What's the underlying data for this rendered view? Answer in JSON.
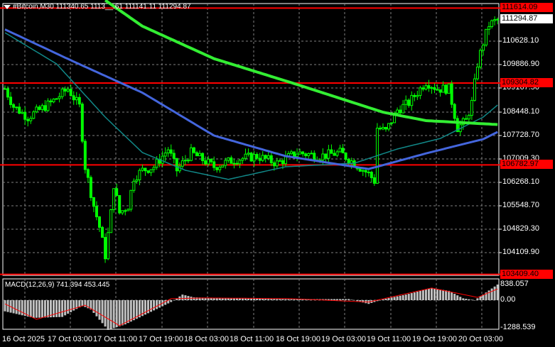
{
  "header": {
    "title": "#Bitcoin,M30  111340.65 1113__.61 111141.11 111294.87",
    "menu_icon": "triangle-down-icon"
  },
  "price_axis": {
    "ticks": [
      "110628.10",
      "109886.90",
      "109167.50",
      "108448.10",
      "107728.70",
      "107009.30",
      "106268.10",
      "105548.70",
      "104829.30",
      "104109.90"
    ],
    "current_price": "111294.87",
    "levels": [
      "111614.09",
      "109304.82",
      "106782.97",
      "103409.40"
    ]
  },
  "macd": {
    "title": "MACD(12,26,9) 741.394 453.445",
    "axis": [
      "838.057",
      "0.00",
      "-1288.539"
    ]
  },
  "time_axis": [
    "16 Oct 2025",
    "17 Oct 03:00",
    "17 Oct 11:00",
    "17 Oct 19:00",
    "18 Oct 03:00",
    "18 Oct 11:00",
    "18 Oct 19:00",
    "19 Oct 03:00",
    "19 Oct 11:00",
    "19 Oct 19:00",
    "20 Oct 03:00"
  ],
  "colors": {
    "candle": "#00ff00",
    "ma_slow": "#33ee33",
    "ma_mid": "#4466dd",
    "ma_fast": "#118888",
    "level": "#ff0000",
    "grid": "#808080",
    "signal": "#ff0000",
    "hist": "#c0c0c0"
  },
  "chart_data": {
    "type": "candlestick",
    "symbol": "#Bitcoin",
    "timeframe": "M30",
    "bars": 173,
    "price_range": [
      103409.4,
      111614.09
    ],
    "close_keypoints": [
      [
        0,
        109174
      ],
      [
        3,
        108627
      ],
      [
        8,
        108299
      ],
      [
        16,
        108737
      ],
      [
        22,
        109174
      ],
      [
        26,
        108627
      ],
      [
        28,
        106769
      ],
      [
        31,
        105567
      ],
      [
        33,
        104911
      ],
      [
        35,
        104036
      ],
      [
        37,
        105348
      ],
      [
        38,
        106222
      ],
      [
        40,
        105348
      ],
      [
        43,
        105567
      ],
      [
        45,
        106441
      ],
      [
        48,
        106660
      ],
      [
        52,
        106769
      ],
      [
        57,
        107316
      ],
      [
        60,
        106660
      ],
      [
        65,
        107206
      ],
      [
        73,
        106769
      ],
      [
        80,
        106987
      ],
      [
        88,
        107097
      ],
      [
        95,
        106878
      ],
      [
        102,
        107206
      ],
      [
        110,
        107097
      ],
      [
        117,
        107206
      ],
      [
        122,
        106878
      ],
      [
        127,
        106550
      ],
      [
        129,
        106331
      ],
      [
        130,
        107971
      ],
      [
        133,
        107862
      ],
      [
        137,
        108518
      ],
      [
        141,
        108737
      ],
      [
        145,
        109174
      ],
      [
        147,
        109393
      ],
      [
        151,
        109174
      ],
      [
        155,
        109174
      ],
      [
        158,
        107971
      ],
      [
        161,
        108190
      ],
      [
        163,
        108737
      ],
      [
        165,
        109940
      ],
      [
        167,
        110595
      ],
      [
        169,
        111142
      ],
      [
        172,
        111295
      ]
    ],
    "ma_slow": [
      [
        35,
        111900
      ],
      [
        48,
        111100
      ],
      [
        73,
        110100
      ],
      [
        102,
        109304
      ],
      [
        132,
        108450
      ],
      [
        147,
        108190
      ],
      [
        172,
        108070
      ]
    ],
    "ma_mid": [
      [
        0,
        111000
      ],
      [
        23,
        110050
      ],
      [
        48,
        109050
      ],
      [
        73,
        107730
      ],
      [
        98,
        107097
      ],
      [
        127,
        106700
      ],
      [
        147,
        107180
      ],
      [
        167,
        107620
      ],
      [
        172,
        107840
      ]
    ],
    "ma_fast": [
      [
        0,
        110900
      ],
      [
        18,
        109940
      ],
      [
        35,
        108299
      ],
      [
        48,
        107206
      ],
      [
        63,
        106660
      ],
      [
        78,
        106380
      ],
      [
        98,
        106769
      ],
      [
        122,
        106878
      ],
      [
        137,
        107316
      ],
      [
        152,
        107640
      ],
      [
        167,
        108300
      ],
      [
        172,
        108670
      ]
    ],
    "levels": [
      111614.09,
      109304.82,
      106782.97,
      103409.4
    ],
    "macd_hist": [
      [
        0,
        -600
      ],
      [
        10,
        -950
      ],
      [
        20,
        -900
      ],
      [
        27,
        -300
      ],
      [
        30,
        -500
      ],
      [
        36,
        -1600
      ],
      [
        42,
        -1300
      ],
      [
        50,
        -700
      ],
      [
        58,
        -100
      ],
      [
        62,
        300
      ],
      [
        66,
        150
      ],
      [
        80,
        100
      ],
      [
        100,
        50
      ],
      [
        120,
        60
      ],
      [
        127,
        -200
      ],
      [
        132,
        50
      ],
      [
        140,
        300
      ],
      [
        149,
        650
      ],
      [
        155,
        500
      ],
      [
        160,
        100
      ],
      [
        164,
        0
      ],
      [
        166,
        200
      ],
      [
        172,
        838
      ]
    ],
    "macd_signal": [
      [
        0,
        -200
      ],
      [
        11,
        -1030
      ],
      [
        28,
        -270
      ],
      [
        40,
        -1370
      ],
      [
        58,
        80
      ],
      [
        70,
        120
      ],
      [
        100,
        80
      ],
      [
        127,
        -100
      ],
      [
        149,
        650
      ],
      [
        165,
        150
      ],
      [
        172,
        600
      ]
    ],
    "macd_range": [
      -1288.539,
      838.057
    ]
  }
}
